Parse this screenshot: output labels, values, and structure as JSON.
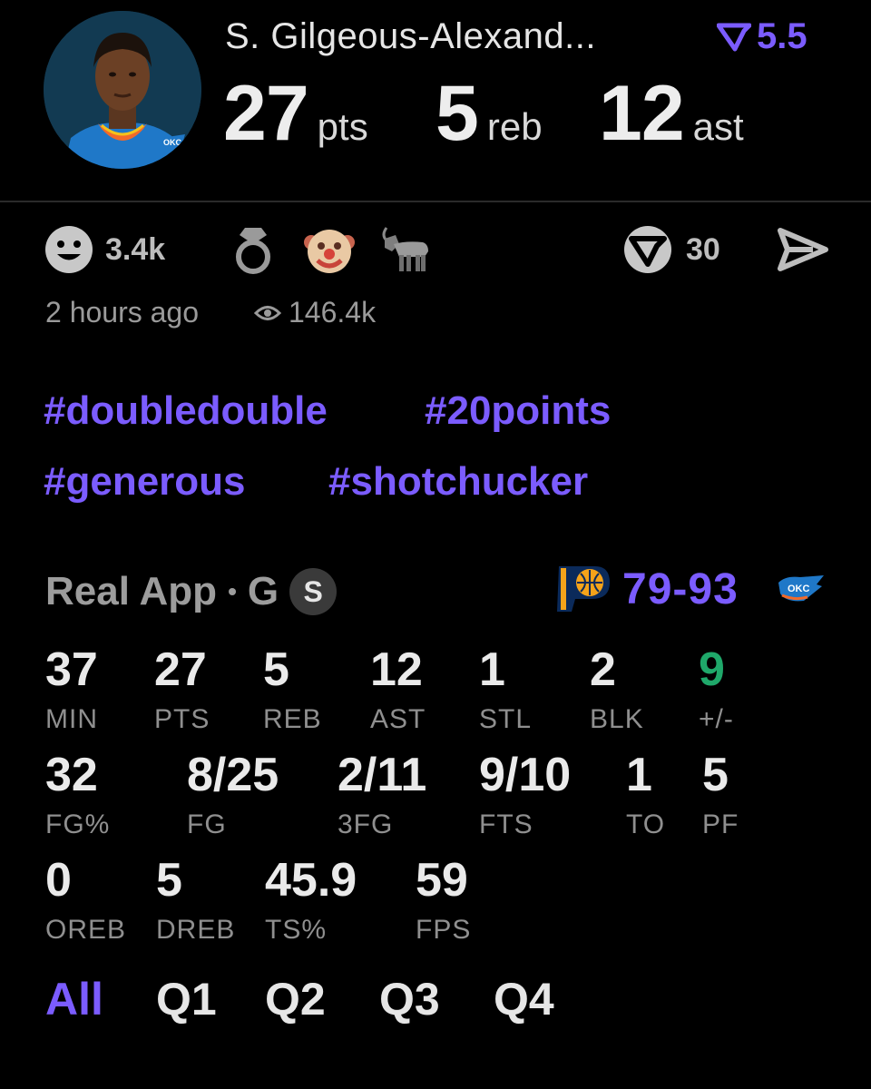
{
  "player": {
    "name": "S. Gilgeous-Alexand...",
    "rating": "5.5",
    "pts": "27",
    "pts_unit": "pts",
    "reb": "5",
    "reb_unit": "reb",
    "ast": "12",
    "ast_unit": "ast"
  },
  "reactions": {
    "smile_count": "3.4k",
    "real_count": "30",
    "icons": [
      "smile-icon",
      "ring-icon",
      "clown-icon",
      "goat-icon",
      "real-logo-icon",
      "send-icon"
    ]
  },
  "post": {
    "time": "2 hours ago",
    "views": "146.4k"
  },
  "tags": [
    "#doubledouble",
    "#20points",
    "#generous",
    "#shotchucker"
  ],
  "game": {
    "source": "Real App",
    "separator": "•",
    "position": "G",
    "badge": "S",
    "score": "79-93",
    "home_team_logo": "pacers-logo-icon",
    "away_team_logo": "okc-logo-icon"
  },
  "stats": {
    "row1": [
      {
        "value": "37",
        "label": "MIN"
      },
      {
        "value": "27",
        "label": "PTS"
      },
      {
        "value": "5",
        "label": "REB"
      },
      {
        "value": "12",
        "label": "AST"
      },
      {
        "value": "1",
        "label": "STL"
      },
      {
        "value": "2",
        "label": "BLK"
      },
      {
        "value": "9",
        "label": "+/-"
      }
    ],
    "row2": [
      {
        "value": "32",
        "label": "FG%"
      },
      {
        "value": "8/25",
        "label": "FG"
      },
      {
        "value": "2/11",
        "label": "3FG"
      },
      {
        "value": "9/10",
        "label": "FTS"
      },
      {
        "value": "1",
        "label": "TO"
      },
      {
        "value": "5",
        "label": "PF"
      }
    ],
    "row3": [
      {
        "value": "0",
        "label": "OREB"
      },
      {
        "value": "5",
        "label": "DREB"
      },
      {
        "value": "45.9",
        "label": "TS%"
      },
      {
        "value": "59",
        "label": "FPS"
      }
    ]
  },
  "colors": {
    "accent": "#7b5cff",
    "positive": "#1fa86a",
    "background": "#000000"
  },
  "quarters": [
    "All",
    "Q1",
    "Q2",
    "Q3",
    "Q4"
  ],
  "active_quarter": "All"
}
